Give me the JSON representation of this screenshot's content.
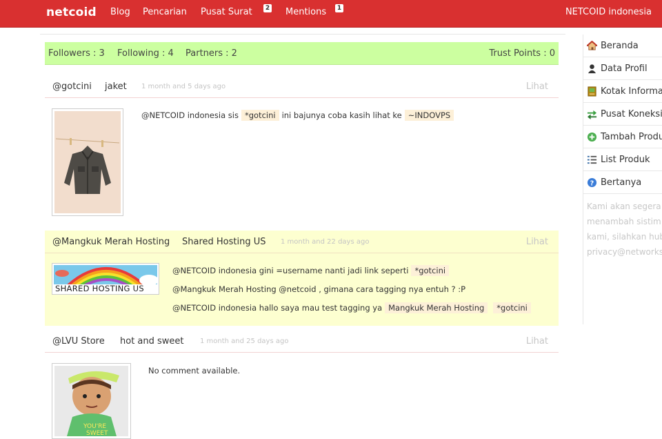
{
  "header": {
    "brand": "netcoid",
    "nav": [
      {
        "label": "Blog"
      },
      {
        "label": "Pencarian"
      },
      {
        "label": "Pusat Surat",
        "badge": "2"
      },
      {
        "label": "Mentions",
        "badge": "1"
      }
    ],
    "user": "NETCOID indonesia"
  },
  "stats": {
    "followers": "Followers : 3",
    "following": "Following : 4",
    "partners": "Partners : 2",
    "trust": "Trust Points : 0"
  },
  "posts": [
    {
      "user": "@gotcini",
      "product": "jaket",
      "time": "1 month and 5 days ago",
      "lihat": "Lihat",
      "comments": [
        {
          "text": "@NETCOID indonesia sis",
          "tags": [
            "*gotcini"
          ],
          "after": "ini bajunya coba kasih lihat ke",
          "tags2": [
            "~INDOVPS"
          ]
        }
      ]
    },
    {
      "user": "@Mangkuk Merah Hosting",
      "product": "Shared Hosting US",
      "time": "1 month and 22 days ago",
      "lihat": "Lihat",
      "image_text": "SHARED HOSTING US",
      "comments": [
        {
          "text": "@NETCOID indonesia gini =username nanti jadi link seperti",
          "tags": [
            "*gotcini"
          ]
        },
        {
          "text": "@Mangkuk Merah Hosting @netcoid , gimana cara tagging nya entuh ? :P"
        },
        {
          "text": "@NETCOID indonesia hallo saya mau test tagging ya",
          "tags": [
            "Mangkuk Merah Hosting",
            "*gotcini"
          ]
        }
      ]
    },
    {
      "user": "@LVU Store",
      "product": "hot and sweet",
      "time": "1 month and 25 days ago",
      "lihat": "Lihat",
      "no_comment": "No comment available."
    }
  ],
  "sidebar": {
    "items": [
      {
        "label": "Beranda",
        "icon": "home-icon"
      },
      {
        "label": "Data Profil",
        "icon": "user-icon"
      },
      {
        "label": "Kotak Informasi",
        "icon": "info-box-icon"
      },
      {
        "label": "Pusat Koneksi",
        "icon": "connection-icon"
      },
      {
        "label": "Tambah Produk",
        "icon": "add-icon"
      },
      {
        "label": "List Produk",
        "icon": "list-icon"
      },
      {
        "label": "Bertanya",
        "icon": "help-icon"
      }
    ],
    "note_lines": [
      "Kami akan segera",
      "menambah sistim p",
      "kami, silahkan hubu",
      "privacy@networks.c"
    ]
  },
  "colors": {
    "header": "#d93030",
    "stats_bg": "#ccffa0",
    "highlight_post": "#fdffd0",
    "tag_bg": "#fdf0d8"
  }
}
